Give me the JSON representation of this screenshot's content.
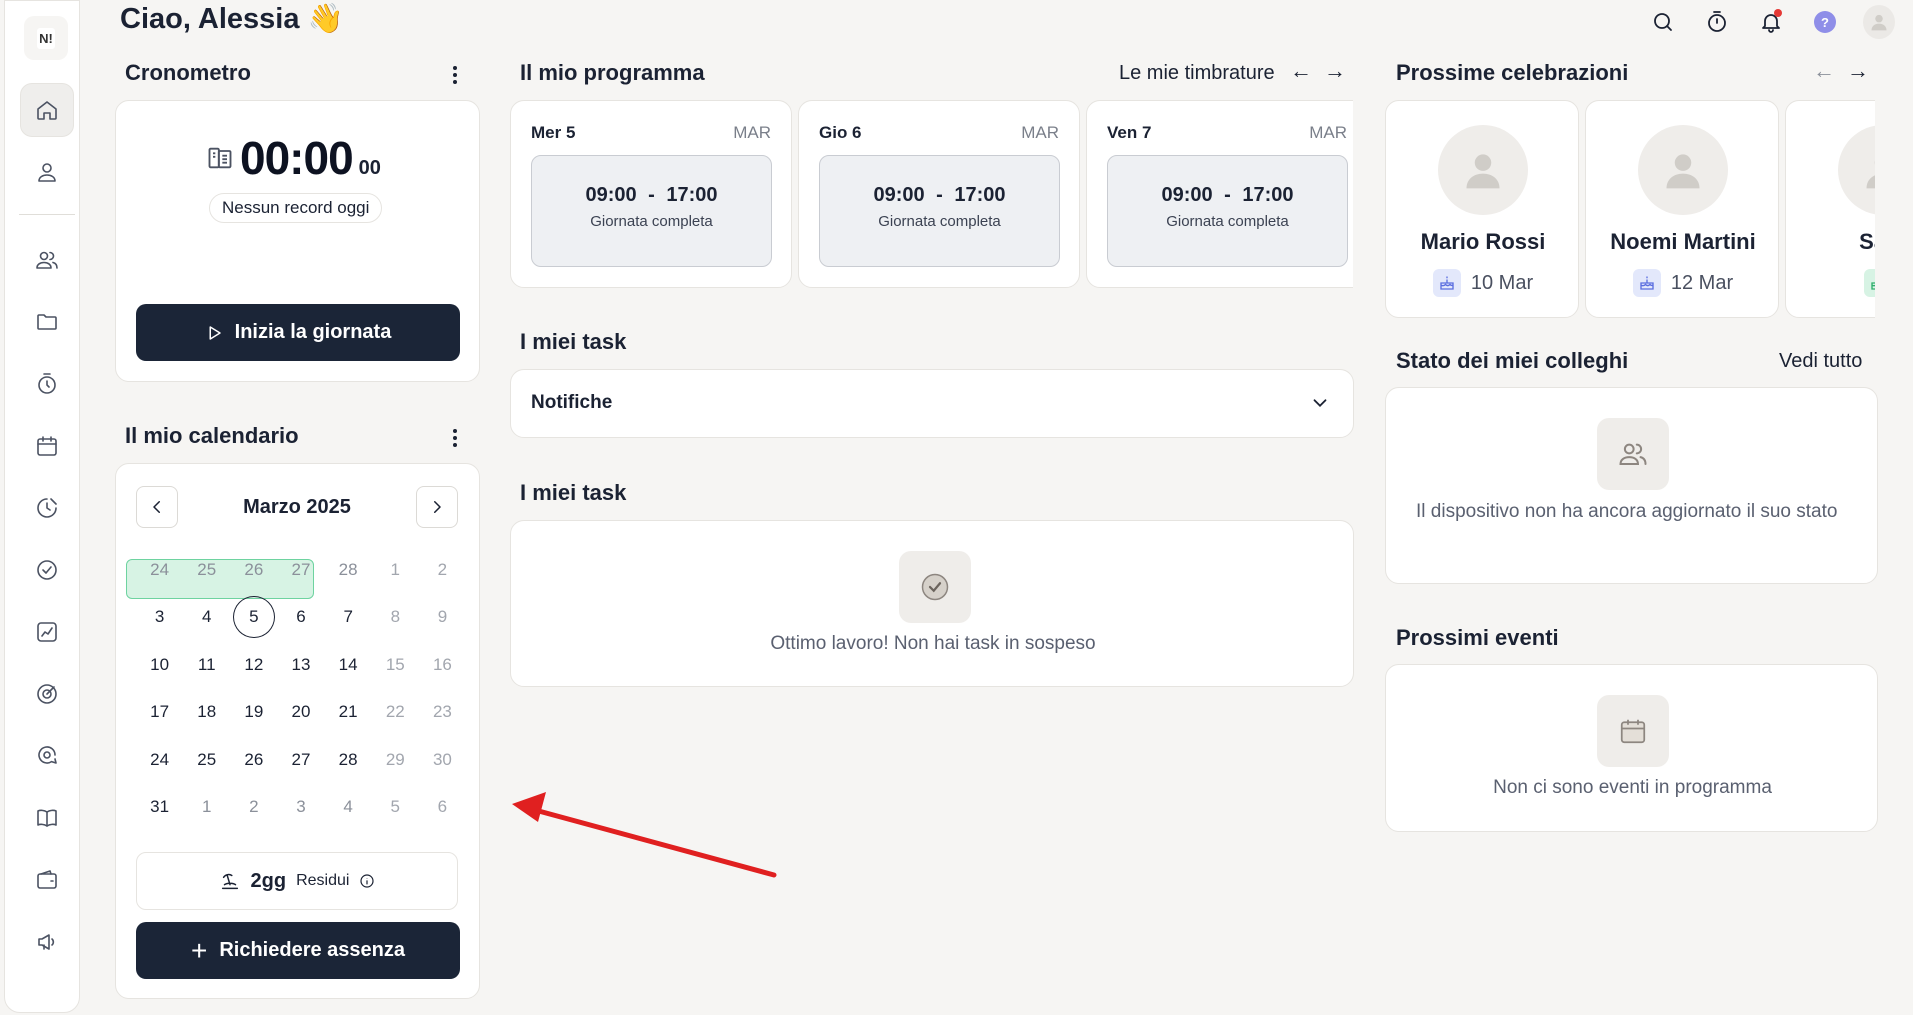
{
  "header": {
    "greeting": "Ciao, Alessia 👋"
  },
  "sidebar": {
    "logo": "N!"
  },
  "stopwatch": {
    "title": "Cronometro",
    "time": "00:00",
    "seconds": "00",
    "status": "Nessun record oggi",
    "start_button": "Inizia la giornata"
  },
  "schedule": {
    "title": "Il mio programma",
    "link": "Le mie timbrature",
    "days": [
      {
        "name": "Mer 5",
        "month": "MAR",
        "time": "09:00 - 17:00",
        "type": "Giornata completa"
      },
      {
        "name": "Gio 6",
        "month": "MAR",
        "time": "09:00 - 17:00",
        "type": "Giornata completa"
      },
      {
        "name": "Ven 7",
        "month": "MAR",
        "time": "09:00 - 17:00",
        "type": "Giornata completa"
      }
    ]
  },
  "tasks": {
    "title1": "I miei task",
    "dropdown": "Notifiche",
    "title2": "I miei task",
    "empty": "Ottimo lavoro! Non hai task in sospeso"
  },
  "calendar": {
    "title": "Il mio calendario",
    "month": "Marzo 2025",
    "weeks": [
      [
        "24",
        "25",
        "26",
        "27",
        "28",
        "1",
        "2"
      ],
      [
        "3",
        "4",
        "5",
        "6",
        "7",
        "8",
        "9"
      ],
      [
        "10",
        "11",
        "12",
        "13",
        "14",
        "15",
        "16"
      ],
      [
        "17",
        "18",
        "19",
        "20",
        "21",
        "22",
        "23"
      ],
      [
        "24",
        "25",
        "26",
        "27",
        "28",
        "29",
        "30"
      ],
      [
        "31",
        "1",
        "2",
        "3",
        "4",
        "5",
        "6"
      ]
    ],
    "residual_value": "2gg",
    "residual_label": "Residui",
    "request_button": "Richiedere assenza"
  },
  "celebrations": {
    "title": "Prossime celebrazioni",
    "people": [
      {
        "name": "Mario Rossi",
        "date": "10 Mar"
      },
      {
        "name": "Noemi Martini",
        "date": "12 Mar"
      },
      {
        "name": "Sara",
        "date": ""
      }
    ]
  },
  "colleagues": {
    "title": "Stato dei miei colleghi",
    "link": "Vedi tutto",
    "empty": "Il dispositivo non ha ancora aggiornato il suo stato"
  },
  "events": {
    "title": "Prossimi eventi",
    "empty": "Non ci sono eventi in programma"
  },
  "colors": {
    "dark_button": "#1b2537",
    "range_highlight": "#d7f3e4",
    "accent_red": "#e53935"
  }
}
